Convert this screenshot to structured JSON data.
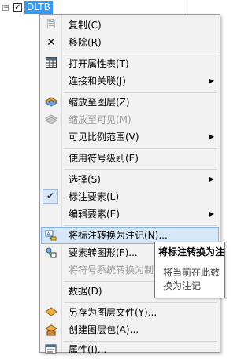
{
  "layer": {
    "name": "DLTB",
    "checked": true
  },
  "menu": {
    "items": [
      {
        "id": "copy",
        "label": "复制(C)",
        "icon": "copy-icon",
        "glyph": "📄",
        "enabled": true
      },
      {
        "id": "remove",
        "label": "移除(R)",
        "icon": "remove-icon",
        "glyph": "✕",
        "enabled": true
      },
      {
        "id": "open-attr-table",
        "label": "打开属性表(T)",
        "icon": "table-icon",
        "glyph": "▦",
        "enabled": true
      },
      {
        "id": "joins-relates",
        "label": "连接和关联(J)",
        "submenu": true,
        "enabled": true
      },
      {
        "id": "zoom-to-layer",
        "label": "缩放至图层(Z)",
        "icon": "zoom-layer-icon",
        "glyph": "◆",
        "enabled": true
      },
      {
        "id": "zoom-to-visible",
        "label": "缩放至可见(M)",
        "icon": "zoom-visible-icon",
        "glyph": "◈",
        "enabled": false
      },
      {
        "id": "visible-scale-range",
        "label": "可见比例范围(V)",
        "submenu": true,
        "enabled": true
      },
      {
        "id": "use-symbol-levels",
        "label": "使用符号级别(E)",
        "enabled": true
      },
      {
        "id": "selection",
        "label": "选择(S)",
        "submenu": true,
        "enabled": true
      },
      {
        "id": "label-features",
        "label": "标注要素(L)",
        "checked": true,
        "enabled": true
      },
      {
        "id": "edit-features",
        "label": "编辑要素(E)",
        "submenu": true,
        "enabled": true
      },
      {
        "id": "convert-labels",
        "label": "将标注转换为注记(N)...",
        "icon": "convert-labels-icon",
        "glyph": "✎",
        "enabled": true,
        "highlighted": true
      },
      {
        "id": "convert-features-to-graphics",
        "label": "要素转图形(F)...",
        "icon": "features-graphics-icon",
        "glyph": "⬔",
        "enabled": true
      },
      {
        "id": "convert-symbology",
        "label": "将符号系统转换为制图",
        "enabled": false
      },
      {
        "id": "data",
        "label": "数据(D)",
        "submenu": true,
        "enabled": true
      },
      {
        "id": "save-as-layer-file",
        "label": "另存为图层文件(Y)...",
        "icon": "layer-file-icon",
        "glyph": "◆",
        "enabled": true
      },
      {
        "id": "create-layer-package",
        "label": "创建图层包(A)...",
        "icon": "layer-package-icon",
        "glyph": "◆",
        "enabled": true
      },
      {
        "id": "properties",
        "label": "属性(I)...",
        "icon": "properties-icon",
        "glyph": "▤",
        "enabled": true
      }
    ]
  },
  "tooltip": {
    "title": "将标注转换为注",
    "body_line1": "将当前在此数",
    "body_line2": "换为注记"
  },
  "colors": {
    "highlight_bg": "#d5e7f8",
    "highlight_border": "#7eb4ea",
    "selection_blue": "#3399ff",
    "disabled_text": "#9c9c9c"
  }
}
